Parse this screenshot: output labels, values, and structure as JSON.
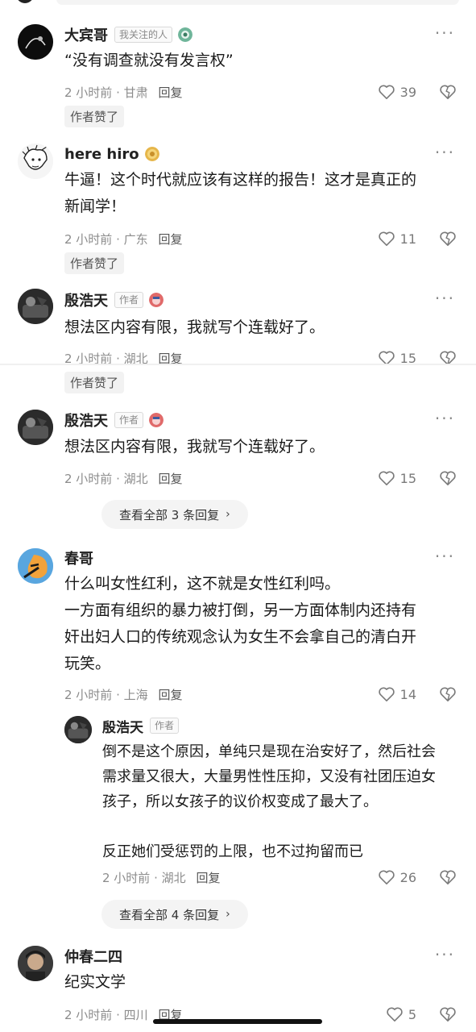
{
  "comments": [
    {
      "name": "大宾哥",
      "tag": "我关注的人",
      "text": "“没有调查就没有发言权”",
      "time": "2 小时前",
      "location": "甘肃",
      "reply": "回复",
      "likes": "39",
      "liked_by_author": "作者赞了"
    },
    {
      "name": "here hiro",
      "text": "牛逼！这个时代就应该有这样的报告！这才是真正的\n新闻学！",
      "time": "2 小时前",
      "location": "广东",
      "reply": "回复",
      "likes": "11",
      "liked_by_author": "作者赞了"
    },
    {
      "name": "殷浩天",
      "tag": "作者",
      "text": "想法区内容有限，我就写个连载好了。",
      "time": "2 小时前",
      "location": "湖北",
      "reply": "回复",
      "likes": "15",
      "liked_by_author": "作者赞了"
    },
    {
      "name": "殷浩天",
      "tag": "作者",
      "text": "想法区内容有限，我就写个连载好了。",
      "time": "2 小时前",
      "location": "湖北",
      "reply": "回复",
      "likes": "15",
      "view_replies": "查看全部 3 条回复"
    },
    {
      "name": "春哥",
      "text": "什么叫女性红利，这不就是女性红利吗。\n一方面有组织的暴力被打倒，另一方面体制内还持有\n奸出妇人口的传统观念认为女生不会拿自己的清白开\n玩笑。",
      "time": "2 小时前",
      "location": "上海",
      "reply": "回复",
      "likes": "14",
      "sub_reply": {
        "name": "殷浩天",
        "tag": "作者",
        "text": "倒不是这个原因，单纯只是现在治安好了，然后社会\n需求量又很大，大量男性性压抑，又没有社团压迫女\n孩子，所以女孩子的议价权变成了最大了。\n\n反正她们受惩罚的上限，也不过拘留而已",
        "time": "2 小时前",
        "location": "湖北",
        "reply": "回复",
        "likes": "26"
      },
      "view_replies": "查看全部 4 条回复"
    },
    {
      "name": "仲春二四",
      "text": "纪实文学",
      "time": "2 小时前",
      "location": "四川",
      "reply": "回复",
      "likes": "5"
    }
  ],
  "icons": {
    "more": "more-dots-icon",
    "like": "heart-icon",
    "dislike": "broken-heart-icon",
    "chevron": "chevron-right-icon"
  },
  "ui": {
    "more_glyph": "···",
    "chevron_glyph": "›",
    "dot_sep": "·"
  }
}
